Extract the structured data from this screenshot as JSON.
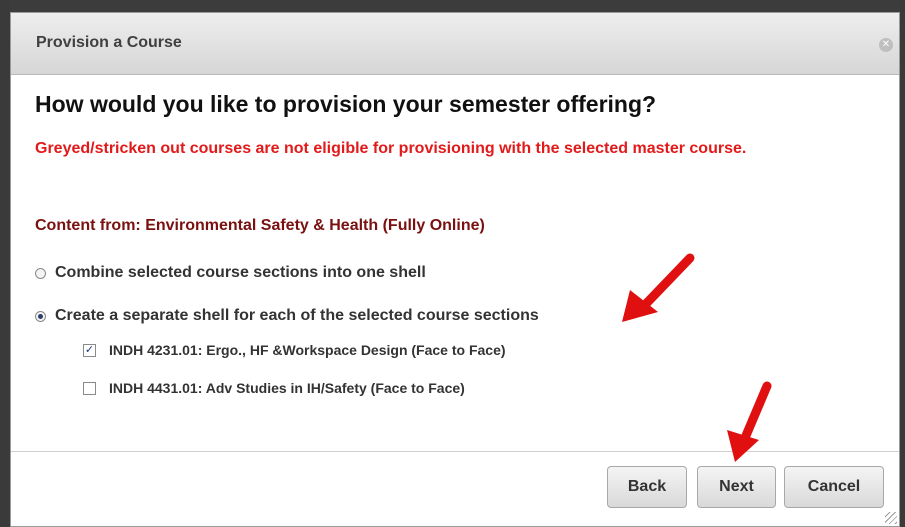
{
  "dialog": {
    "title": "Provision a Course",
    "close_icon": "close-icon",
    "heading": "How would you like to provision your semester offering?",
    "warning": "Greyed/stricken out courses are not eligible for provisioning with the selected master course.",
    "content_from": "Content from: Environmental Safety & Health (Fully Online)",
    "options": [
      {
        "label": "Combine selected course sections into one shell",
        "selected": false
      },
      {
        "label": "Create a separate shell for each of the selected course sections",
        "selected": true
      }
    ],
    "sections": [
      {
        "label": "INDH 4231.01: Ergo., HF &Workspace Design (Face to Face)",
        "checked": true
      },
      {
        "label": "INDH 4431.01: Adv Studies in IH/Safety (Face to Face)",
        "checked": false
      }
    ],
    "buttons": {
      "back": "Back",
      "next": "Next",
      "cancel": "Cancel"
    }
  },
  "colors": {
    "warning": "#e21a1a",
    "content_from": "#7a1010",
    "annotation_arrow": "#e01010"
  }
}
